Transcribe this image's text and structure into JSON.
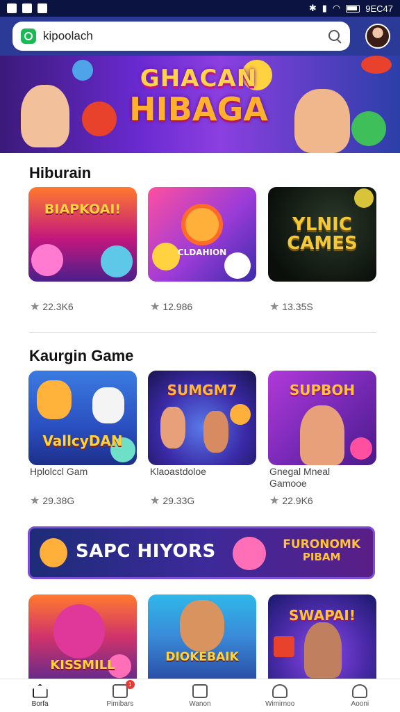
{
  "status_bar": {
    "time": "9EC47"
  },
  "search": {
    "value": "kipoolach"
  },
  "hero": {
    "line1": "GHACAN",
    "line2": "HIBAGA"
  },
  "section1": {
    "title": "Hiburain",
    "cards": [
      {
        "art_text": "BIAPKOAI!",
        "rating": "22.3K6"
      },
      {
        "art_text": "CLDAHION",
        "rating": "12.986"
      },
      {
        "art_text": "YLNIC CAMES",
        "rating": "13.35S"
      }
    ]
  },
  "section2": {
    "title": "Kaurgin Game",
    "cards": [
      {
        "art_text": "VallcyDAN",
        "name": "Hplolccl Gam",
        "rating": "29.38G"
      },
      {
        "art_text": "SUMGM7",
        "name": "Klaoastdoloe",
        "rating": "29.33G"
      },
      {
        "art_text": "SUPBOH",
        "name": "Gnegal Mneal Gamooe",
        "rating": "22.9K6"
      }
    ]
  },
  "promo": {
    "left": "SAPC HIYORS",
    "right_line1": "FURONOMK",
    "right_line2": "PIBAM"
  },
  "section3": {
    "cards": [
      {
        "art_text": "KISSMILL"
      },
      {
        "art_text": "DIOKEBAIK"
      },
      {
        "art_text": "SWAPAI!"
      }
    ]
  },
  "bottom_nav": {
    "items": [
      {
        "label": "Borfa",
        "icon": "home-icon"
      },
      {
        "label": "Pimibars",
        "icon": "wallet-icon",
        "badge": "1"
      },
      {
        "label": "Wanon",
        "icon": "square-icon"
      },
      {
        "label": "Wimirnoo",
        "icon": "user-icon"
      },
      {
        "label": "Aooni",
        "icon": "profile-icon"
      }
    ]
  },
  "colors": {
    "header": "#2a3a96",
    "status_bar": "#0b1440",
    "accent": "#1db954"
  }
}
